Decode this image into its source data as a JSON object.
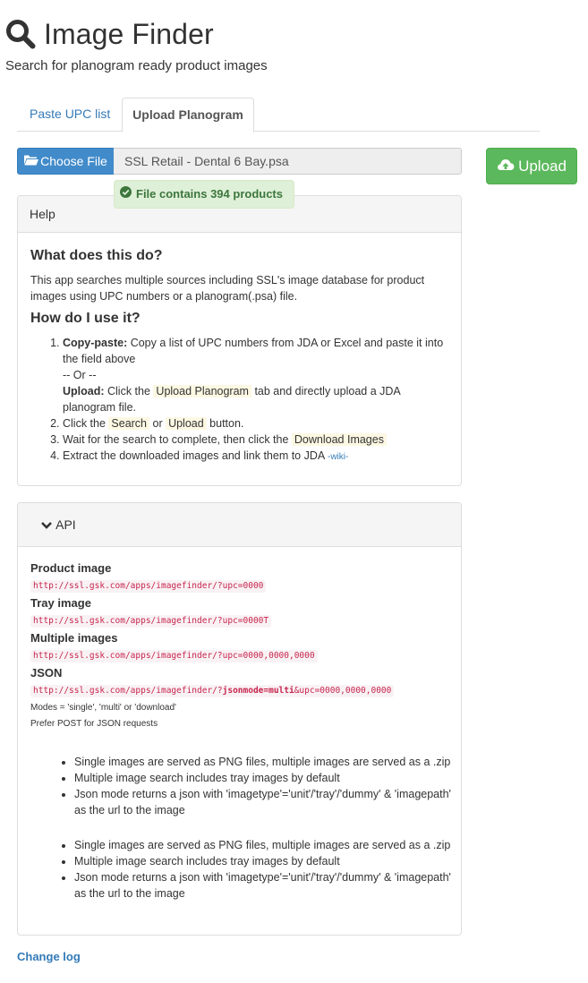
{
  "header": {
    "title": "Image Finder",
    "subtitle": "Search for planogram ready product images"
  },
  "tabs": [
    {
      "label": "Paste UPC list",
      "active": false
    },
    {
      "label": "Upload Planogram",
      "active": true
    }
  ],
  "file_input": {
    "button_label": "Choose File",
    "file_name": "SSL Retail - Dental 6 Bay.psa",
    "status": "File contains 394 products"
  },
  "upload_button": {
    "label": "Upload"
  },
  "help": {
    "heading": "Help",
    "what_title": "What does this do?",
    "what_text": "This app searches multiple sources including SSL's image database for product images using UPC numbers or a planogram(.psa) file.",
    "how_title": "How do I use it?",
    "steps": {
      "s1_strong": "Copy-paste:",
      "s1_text": " Copy a list of UPC numbers from JDA or Excel and paste it into the field above",
      "s1_or": "-- Or --",
      "s1b_strong": "Upload:",
      "s1b_pre": " Click the ",
      "s1b_mark": "Upload Planogram",
      "s1b_post": " tab and directly upload a JDA planogram file.",
      "s2_pre": "Click the ",
      "s2_mark1": "Search",
      "s2_mid": " or ",
      "s2_mark2": "Upload",
      "s2_post": " button.",
      "s3_pre": "Wait for the search to complete, then click the ",
      "s3_mark": "Download Images",
      "s4_pre": "Extract the downloaded images and link them to JDA ",
      "s4_link": "-wiki-"
    }
  },
  "api": {
    "heading": "API",
    "product_label": "Product image",
    "product_url": "http://ssl.gsk.com/apps/imagefinder/?upc=0000",
    "tray_label": "Tray image",
    "tray_url": "http://ssl.gsk.com/apps/imagefinder/?upc=0000T",
    "multi_label": "Multiple images",
    "multi_url": "http://ssl.gsk.com/apps/imagefinder/?upc=0000,0000,0000",
    "json_label": "JSON",
    "json_url_pre": "http://ssl.gsk.com/apps/imagefinder/?",
    "json_url_bold": "jsonmode=multi",
    "json_url_post": "&upc=0000,0000,0000",
    "modes_note": "Modes = 'single', 'multi' or 'download'",
    "post_note": "Prefer POST for JSON requests",
    "notes": [
      "Single images are served as PNG files, multiple images are served as a .zip",
      "Multiple image search includes tray images by default",
      "Json mode returns a json with 'imagetype'='unit'/'tray'/'dummy' & 'imagepath' as the url to the image"
    ],
    "notes_repeat": [
      "Single images are served as PNG files, multiple images are served as a .zip",
      "Multiple image search includes tray images by default",
      "Json mode returns a json with 'imagetype'='unit'/'tray'/'dummy' & 'imagepath' as the url to the image"
    ]
  },
  "footer": {
    "changelog_link": "Change log"
  },
  "colors": {
    "primary": "#428bca",
    "success": "#5cb85c",
    "success_bg": "#dff0d8",
    "success_text": "#3c763d",
    "link": "#337ab7",
    "code_text": "#c7254e",
    "mark_bg": "#fcf8e3"
  },
  "icons": [
    "search-icon",
    "folder-open-icon",
    "cloud-upload-icon",
    "check-circle-icon",
    "chevron-down-icon"
  ]
}
